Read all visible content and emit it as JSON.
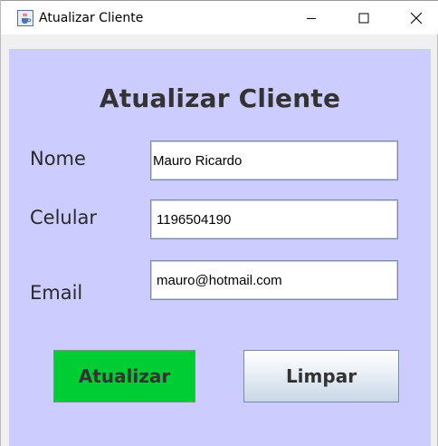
{
  "window": {
    "title": "Atualizar Cliente",
    "icon": "java-cup-icon",
    "controls": [
      "minimize-icon",
      "maximize-icon",
      "close-icon"
    ]
  },
  "form": {
    "heading": "Atualizar Cliente",
    "fields": {
      "nome": {
        "label": "Nome",
        "value": "Mauro Ricardo"
      },
      "celular": {
        "label": "Celular",
        "value": "1196504190"
      },
      "email": {
        "label": "Email",
        "value": "mauro@hotmail.com"
      }
    },
    "buttons": {
      "atualizar": "Atualizar",
      "limpar": "Limpar"
    }
  },
  "colors": {
    "panel_background": "#ccccff",
    "atualizar_button": "#00cc33",
    "text_dark": "#333333"
  }
}
